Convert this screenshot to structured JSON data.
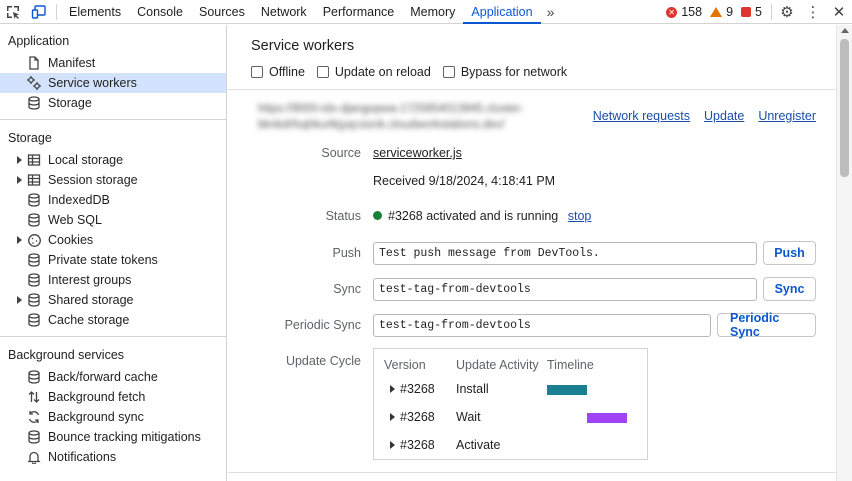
{
  "toolbar": {
    "tabs": [
      "Elements",
      "Console",
      "Sources",
      "Network",
      "Performance",
      "Memory",
      "Application"
    ],
    "active_tab": "Application",
    "more_tabs": "»",
    "error_count": "158",
    "warning_count": "9",
    "issue_count": "5",
    "colors": {
      "active": "#0b57d0",
      "error": "#dc362e",
      "warning": "#e37400"
    }
  },
  "sidebar": {
    "application_header": "Application",
    "application_items": [
      {
        "label": "Manifest",
        "icon": "file-icon"
      },
      {
        "label": "Service workers",
        "icon": "gears-icon",
        "selected": true
      },
      {
        "label": "Storage",
        "icon": "database-icon"
      }
    ],
    "storage_header": "Storage",
    "storage_items": [
      {
        "label": "Local storage",
        "icon": "table-icon",
        "expandable": true
      },
      {
        "label": "Session storage",
        "icon": "table-icon",
        "expandable": true
      },
      {
        "label": "IndexedDB",
        "icon": "database-icon"
      },
      {
        "label": "Web SQL",
        "icon": "database-icon"
      },
      {
        "label": "Cookies",
        "icon": "cookie-icon",
        "expandable": true
      },
      {
        "label": "Private state tokens",
        "icon": "database-icon"
      },
      {
        "label": "Interest groups",
        "icon": "database-icon"
      },
      {
        "label": "Shared storage",
        "icon": "database-icon",
        "expandable": true
      },
      {
        "label": "Cache storage",
        "icon": "database-icon"
      }
    ],
    "background_header": "Background services",
    "background_items": [
      {
        "label": "Back/forward cache",
        "icon": "database-icon"
      },
      {
        "label": "Background fetch",
        "icon": "up-down-arrows-icon"
      },
      {
        "label": "Background sync",
        "icon": "sync-icon"
      },
      {
        "label": "Bounce tracking mitigations",
        "icon": "database-icon"
      },
      {
        "label": "Notifications",
        "icon": "bell-icon"
      }
    ]
  },
  "main": {
    "title": "Service workers",
    "options": [
      "Offline",
      "Update on reload",
      "Bypass for network"
    ],
    "worker_url_blurred": "https://9000-idx-djangopwa-1725854013945.cluster-bknkdrfsqhkurlkjyqcsixnk.cloudworkstations.dev/",
    "links": [
      "Network requests",
      "Update",
      "Unregister"
    ],
    "source_label": "Source",
    "source_link": "serviceworker.js",
    "received": "Received 9/18/2024, 4:18:41 PM",
    "status_label": "Status",
    "status_text": "#3268 activated and is running",
    "status_stop": "stop",
    "push_label": "Push",
    "push_value": "Test push message from DevTools.",
    "push_button": "Push",
    "sync_label": "Sync",
    "sync_value": "test-tag-from-devtools",
    "sync_button": "Sync",
    "periodic_label": "Periodic Sync",
    "periodic_value": "test-tag-from-devtools",
    "periodic_button": "Periodic Sync",
    "update_cycle_label": "Update Cycle",
    "update_cycle": {
      "headers": [
        "Version",
        "Update Activity",
        "Timeline"
      ],
      "rows": [
        {
          "version": "#3268",
          "activity": "Install",
          "bar_color": "#1a8091"
        },
        {
          "version": "#3268",
          "activity": "Wait",
          "bar_color": "#a142f4"
        },
        {
          "version": "#3268",
          "activity": "Activate",
          "bar_color": ""
        }
      ]
    }
  }
}
